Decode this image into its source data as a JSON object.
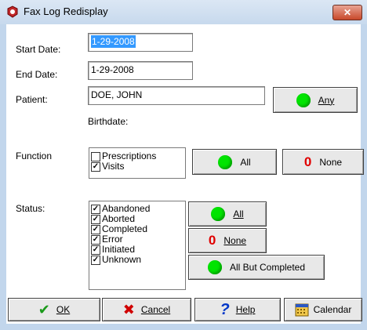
{
  "window": {
    "title": "Fax Log Redisplay",
    "close_glyph": "✕"
  },
  "form": {
    "start_date_label": "Start Date:",
    "start_date_value": "1-29-2008",
    "end_date_label": "End Date:",
    "end_date_value": "1-29-2008",
    "patient_label": "Patient:",
    "patient_value": "DOE, JOHN",
    "any_label": "Any",
    "birthdate_label": "Birthdate:"
  },
  "function": {
    "label": "Function",
    "items": [
      {
        "label": "Prescriptions",
        "checked": false
      },
      {
        "label": "Visits",
        "checked": true
      }
    ],
    "all_label": "All",
    "none_label": "None"
  },
  "status": {
    "label": "Status:",
    "items": [
      {
        "label": "Abandoned",
        "checked": true
      },
      {
        "label": "Aborted",
        "checked": true
      },
      {
        "label": "Completed",
        "checked": true
      },
      {
        "label": "Error",
        "checked": true
      },
      {
        "label": "Initiated",
        "checked": true
      },
      {
        "label": "Unknown",
        "checked": true
      }
    ],
    "all_label": "All",
    "none_label": "None",
    "all_but_completed_label": "All But Completed"
  },
  "footer": {
    "ok_label": "OK",
    "cancel_label": "Cancel",
    "help_label": "Help",
    "calendar_label": "Calendar"
  },
  "icons": {
    "green_dot_color": "#00e400",
    "none_zero": "0",
    "ok_check": "✔",
    "cancel_x": "✖",
    "help_q": "?"
  }
}
